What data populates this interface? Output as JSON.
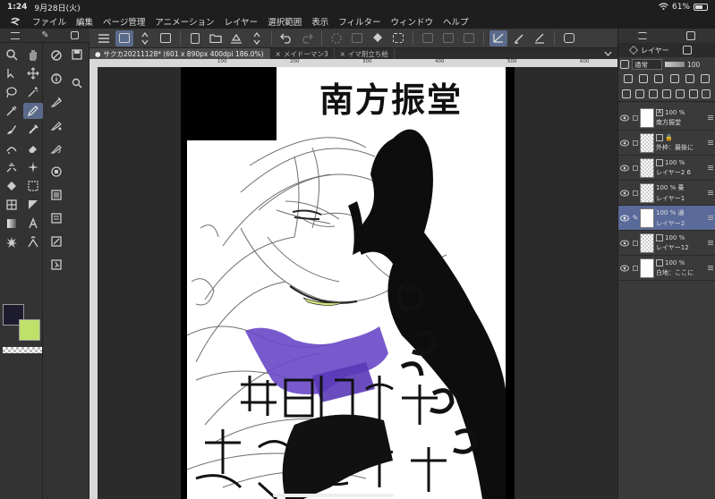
{
  "status": {
    "time": "1:24",
    "date": "9月28日(火)",
    "battery": "61%"
  },
  "menu": [
    "ファイル",
    "編集",
    "ページ管理",
    "アニメーション",
    "レイヤー",
    "選択範囲",
    "表示",
    "フィルター",
    "ウィンドウ",
    "ヘルプ"
  ],
  "tabs": [
    {
      "label": "サクカ20211128* (601 x 890px 400dpi 186.0%)",
      "active": true
    },
    {
      "label": "メイドーマン3",
      "active": false
    },
    {
      "label": "イマ剤立ち絵",
      "active": false
    }
  ],
  "ruler": [
    "100",
    "200",
    "300",
    "400",
    "500",
    "600"
  ],
  "canvas": {
    "title": "南方振堂"
  },
  "colors": {
    "main": "#1d1b2e",
    "sub": "#bfe16a",
    "selected_layer": "#5a6a9a",
    "accent_tool": "#5a6a8a"
  },
  "layer_panel": {
    "tab_label": "レイヤー",
    "blend_mode": "通常",
    "opacity": "100",
    "layers": [
      {
        "opacity": "100 %",
        "name": "南方振堂",
        "type_icon": "A",
        "selected": false,
        "thumb": "text"
      },
      {
        "opacity": "",
        "name": "外枠：最後に",
        "type_icon": "",
        "selected": false,
        "thumb": "frame"
      },
      {
        "opacity": "100 %",
        "name": "レイヤー2 6",
        "type_icon": "",
        "selected": false,
        "thumb": "sketch"
      },
      {
        "opacity": "100 % 乗",
        "name": "レイヤー1",
        "type_icon": "",
        "selected": false,
        "thumb": "sketch"
      },
      {
        "opacity": "100 % 通",
        "name": "レイヤー2",
        "type_icon": "",
        "selected": true,
        "thumb": "char"
      },
      {
        "opacity": "100 %",
        "name": "レイヤー12",
        "type_icon": "",
        "selected": false,
        "thumb": "sketch"
      },
      {
        "opacity": "100 %",
        "name": "白地：ここに",
        "type_icon": "",
        "selected": false,
        "thumb": "white"
      }
    ]
  }
}
